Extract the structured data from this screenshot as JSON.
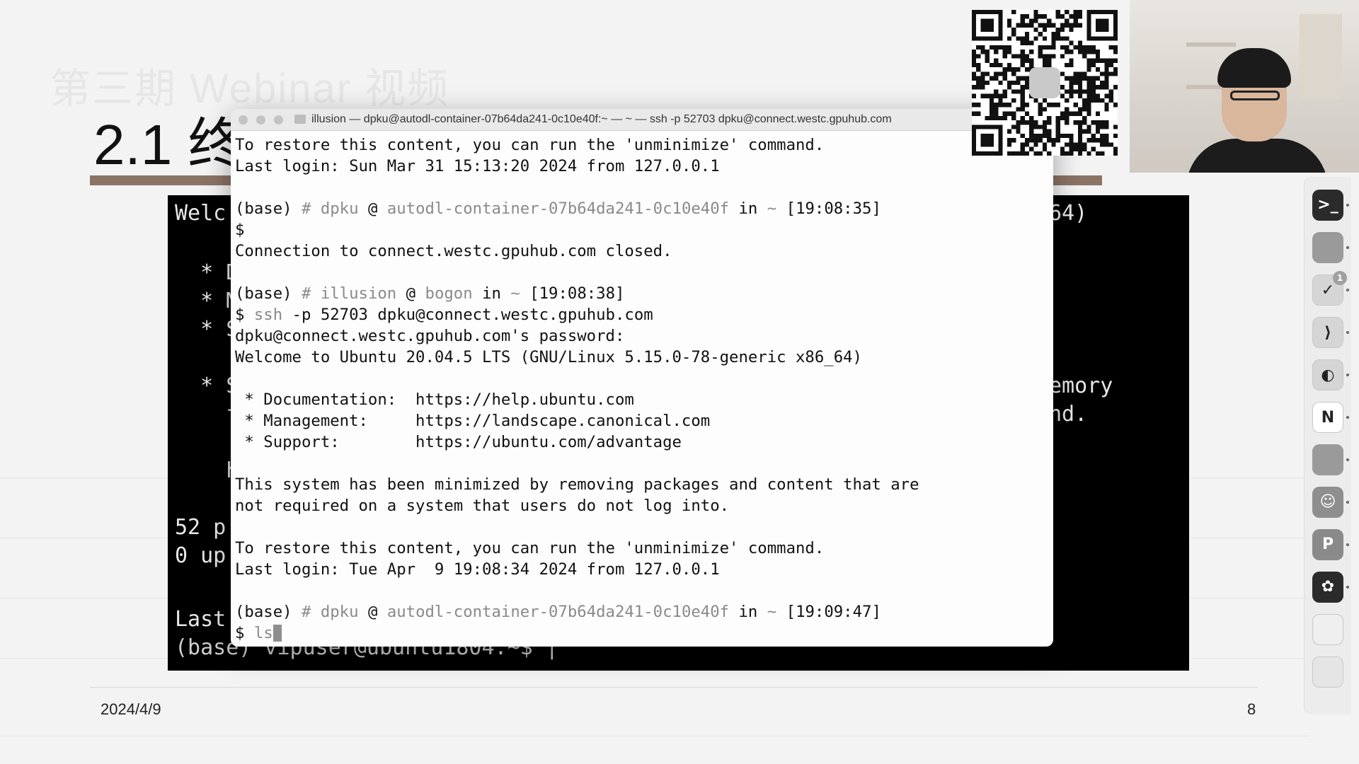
{
  "slide": {
    "watermark": "第三期 Webinar 视频",
    "title": "2.1 终",
    "date": "2024/4/9",
    "page_number": "8"
  },
  "background_terminal": {
    "lines": [
      "Welc",
      "  * D",
      "  * M",
      "  * S",
      "  * S",
      "    f",
      "    h",
      "52 p",
      "0 up",
      "Last",
      "(base) vipuser@ubuntu1804:~$ |"
    ],
    "right_fragments": [
      "64)",
      "emory",
      "nd."
    ]
  },
  "terminal": {
    "title": "illusion — dpku@autodl-container-07b64da241-0c10e40f:~ — ~ — ssh -p 52703 dpku@connect.westc.gpuhub.com",
    "lines": [
      {
        "text": "To restore this content, you can run the 'unminimize' command."
      },
      {
        "text": "Last login: Sun Mar 31 15:13:20 2024 from 127.0.0.1"
      },
      {
        "text": ""
      },
      {
        "segments": [
          [
            "(base) ",
            ""
          ],
          [
            "# ",
            "dim"
          ],
          [
            "dpku",
            "dim"
          ],
          [
            " @ ",
            ""
          ],
          [
            "autodl-container-07b64da241-0c10e40f",
            "dim"
          ],
          [
            " in ",
            ""
          ],
          [
            "~",
            "dim"
          ],
          [
            " [19:08:35]",
            ""
          ]
        ]
      },
      {
        "text": "$"
      },
      {
        "text": "Connection to connect.westc.gpuhub.com closed."
      },
      {
        "text": ""
      },
      {
        "segments": [
          [
            "(base) ",
            ""
          ],
          [
            "# ",
            "dim"
          ],
          [
            "illusion",
            "dim"
          ],
          [
            " @ ",
            ""
          ],
          [
            "bogon",
            "dim"
          ],
          [
            " in ",
            ""
          ],
          [
            "~",
            "dim"
          ],
          [
            " [19:08:38]",
            ""
          ]
        ]
      },
      {
        "segments": [
          [
            "$ ",
            ""
          ],
          [
            "ssh",
            "dim"
          ],
          [
            " -p 52703 dpku@connect.westc.gpuhub.com",
            ""
          ]
        ]
      },
      {
        "text": "dpku@connect.westc.gpuhub.com's password:"
      },
      {
        "text": "Welcome to Ubuntu 20.04.5 LTS (GNU/Linux 5.15.0-78-generic x86_64)"
      },
      {
        "text": ""
      },
      {
        "text": " * Documentation:  https://help.ubuntu.com"
      },
      {
        "text": " * Management:     https://landscape.canonical.com"
      },
      {
        "text": " * Support:        https://ubuntu.com/advantage"
      },
      {
        "text": ""
      },
      {
        "text": "This system has been minimized by removing packages and content that are"
      },
      {
        "text": "not required on a system that users do not log into."
      },
      {
        "text": ""
      },
      {
        "text": "To restore this content, you can run the 'unminimize' command."
      },
      {
        "text": "Last login: Tue Apr  9 19:08:34 2024 from 127.0.0.1"
      },
      {
        "text": ""
      },
      {
        "segments": [
          [
            "(base) ",
            ""
          ],
          [
            "# ",
            "dim"
          ],
          [
            "dpku",
            "dim"
          ],
          [
            " @ ",
            ""
          ],
          [
            "autodl-container-07b64da241-0c10e40f",
            "dim"
          ],
          [
            " in ",
            ""
          ],
          [
            "~",
            "dim"
          ],
          [
            " [19:09:47]",
            ""
          ]
        ]
      },
      {
        "segments": [
          [
            "$ ",
            ""
          ],
          [
            "ls",
            "dim"
          ]
        ],
        "cursor": true
      }
    ]
  },
  "dock": {
    "apps": [
      {
        "name": "terminal-app-icon",
        "glyph": ">_",
        "color": "#2b2b2b"
      },
      {
        "name": "wechat-app-icon",
        "glyph": "",
        "color": "#9a9a9a"
      },
      {
        "name": "ticktick-app-icon",
        "glyph": "✓",
        "color": "#d5d5d5",
        "badge": "1"
      },
      {
        "name": "vscode-app-icon",
        "glyph": "⟩",
        "color": "#d5d5d5"
      },
      {
        "name": "edge-app-icon",
        "glyph": "◐",
        "color": "#d5d5d5"
      },
      {
        "name": "notion-app-icon",
        "glyph": "N",
        "color": "#ffffff"
      },
      {
        "name": "finder-app-icon",
        "glyph": "",
        "color": "#9a9a9a"
      },
      {
        "name": "discord-app-icon",
        "glyph": "☺",
        "color": "#8e8e8e"
      },
      {
        "name": "powerpoint-app-icon",
        "glyph": "P",
        "color": "#8a8a8a"
      },
      {
        "name": "chatgpt-app-icon",
        "glyph": "✿",
        "color": "#2b2b2b"
      },
      {
        "name": "notes-app-icon",
        "glyph": "",
        "color": "#efefef"
      },
      {
        "name": "trash-app-icon",
        "glyph": "",
        "color": "#e5e5e5"
      }
    ]
  }
}
